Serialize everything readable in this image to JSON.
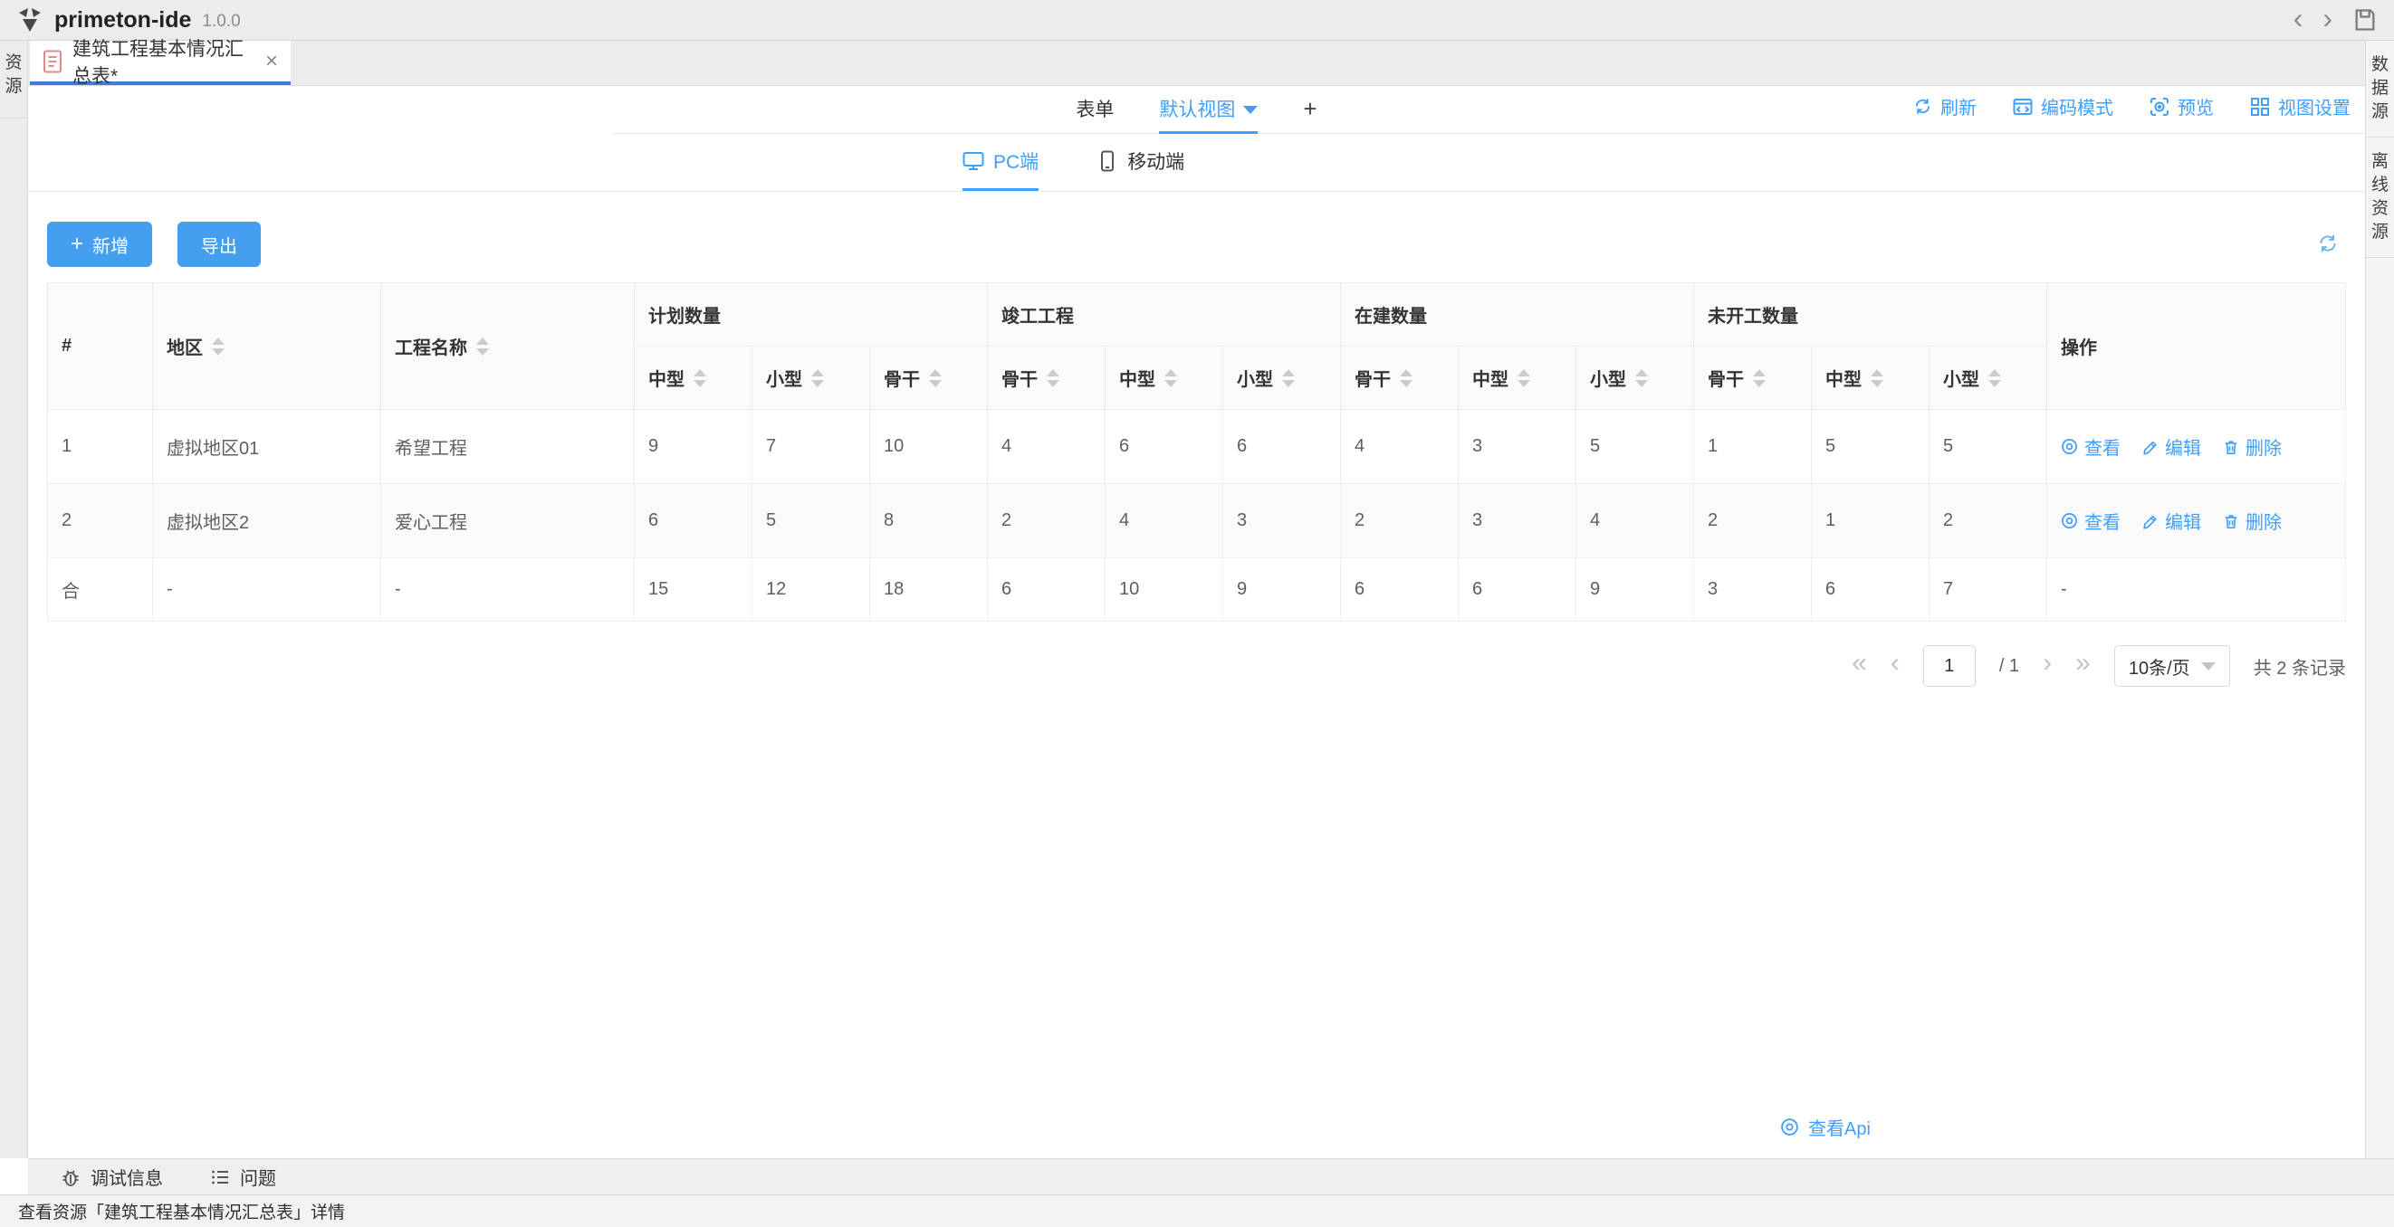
{
  "app": {
    "name": "primeton-ide",
    "version": "1.0.0"
  },
  "titlebar": {
    "back": "‹",
    "forward": "›"
  },
  "left_rail": {
    "resources": "资源"
  },
  "right_rail": {
    "datasource": "数据源",
    "offline": "离线资源"
  },
  "file_tab": {
    "title": "建筑工程基本情况汇总表*",
    "close": "×"
  },
  "view_tabs": {
    "form": "表单",
    "active_view": "默认视图",
    "add_view": "+"
  },
  "view_toolbar": {
    "refresh": "刷新",
    "code_mode": "编码模式",
    "preview": "预览",
    "view_settings": "视图设置"
  },
  "device_tabs": {
    "pc": "PC端",
    "mobile": "移动端"
  },
  "list_actions": {
    "add_plus": "+",
    "add": "新增",
    "export": "导出"
  },
  "table": {
    "col_index": "#",
    "col_region": "地区",
    "col_project": "工程名称",
    "col_actions": "操作",
    "groups": [
      {
        "label": "计划数量",
        "children": [
          "中型",
          "小型",
          "骨干"
        ]
      },
      {
        "label": "竣工工程",
        "children": [
          "骨干",
          "中型",
          "小型"
        ]
      },
      {
        "label": "在建数量",
        "children": [
          "骨干",
          "中型",
          "小型"
        ]
      },
      {
        "label": "未开工数量",
        "children": [
          "骨干",
          "中型",
          "小型"
        ]
      }
    ],
    "rows": [
      {
        "index": "1",
        "region": "虚拟地区01",
        "project": "希望工程",
        "values": [
          "9",
          "7",
          "10",
          "4",
          "6",
          "6",
          "4",
          "3",
          "5",
          "1",
          "5",
          "5"
        ]
      },
      {
        "index": "2",
        "region": "虚拟地区2",
        "project": "爱心工程",
        "values": [
          "6",
          "5",
          "8",
          "2",
          "4",
          "3",
          "2",
          "3",
          "4",
          "2",
          "1",
          "2"
        ]
      }
    ],
    "summary": {
      "index": "合",
      "region": "-",
      "project": "-",
      "values": [
        "15",
        "12",
        "18",
        "6",
        "10",
        "9",
        "6",
        "6",
        "9",
        "3",
        "6",
        "7"
      ],
      "actions": "-"
    }
  },
  "row_actions": {
    "view": "查看",
    "edit": "编辑",
    "remove": "删除"
  },
  "pagination": {
    "page": "1",
    "of": "/ 1",
    "page_size": "10条/页",
    "total": "共 2 条记录"
  },
  "api_link": {
    "label": "查看Api"
  },
  "bottom_panel": {
    "debug": "调试信息",
    "problems": "问题"
  },
  "status_bar": {
    "text": "查看资源「建筑工程基本情况汇总表」详情"
  },
  "colors": {
    "accent": "#409EFF",
    "button": "#459FF0",
    "tab_underline": "#3E7CD9",
    "success_green": "#54C22E"
  }
}
